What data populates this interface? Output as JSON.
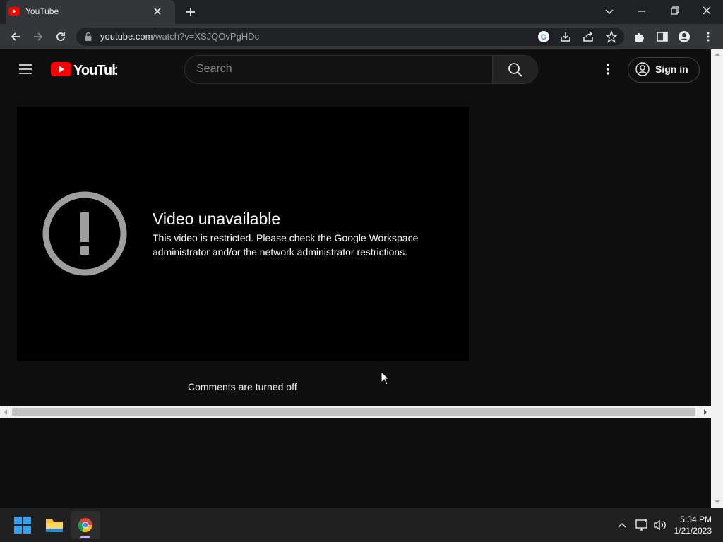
{
  "browser": {
    "tab_title": "YouTube",
    "url_host": "youtube.com",
    "url_path": "/watch?v=XSJQOvPgHDc"
  },
  "youtube": {
    "logo_text": "YouTube",
    "search_placeholder": "Search",
    "signin_label": "Sign in",
    "error_title": "Video unavailable",
    "error_message": "This video is restricted. Please check the Google Workspace administrator and/or the network administrator restrictions.",
    "comments_status": "Comments are turned off"
  },
  "taskbar": {
    "time": "5:34 PM",
    "date": "1/21/2023"
  },
  "colors": {
    "youtube_red": "#ff0000",
    "page_bg": "#0f0f0f",
    "chrome_dark": "#202124"
  }
}
